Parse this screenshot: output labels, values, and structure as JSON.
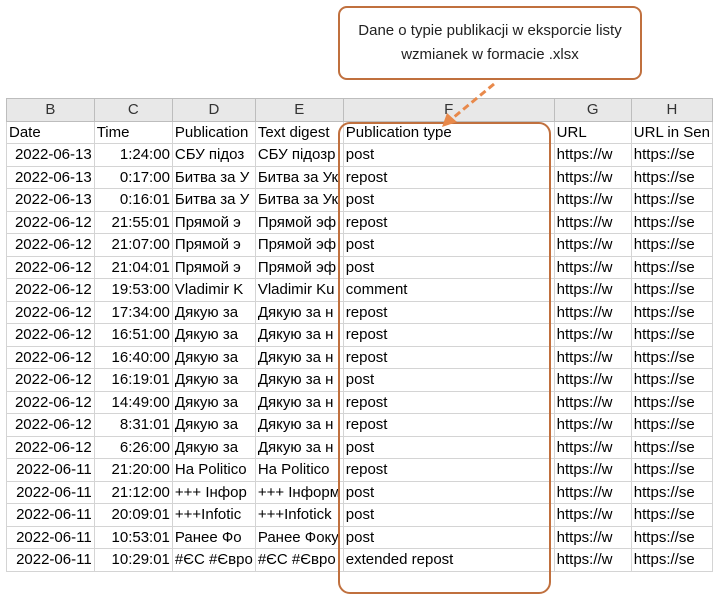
{
  "callout": {
    "text": "Dane o typie publikacji w eksporcie listy wzmianek w formacie .xlsx"
  },
  "sheet": {
    "column_letters": [
      "B",
      "C",
      "D",
      "E",
      "F",
      "G",
      "H"
    ],
    "headers": [
      "Date",
      "Time",
      "Publication",
      "Text digest",
      "Publication type",
      "URL",
      "URL in Sen"
    ],
    "rows": [
      [
        "2022-06-13",
        "1:24:00",
        "СБУ підоз",
        "СБУ підозр",
        "post",
        "https://w",
        "https://se"
      ],
      [
        "2022-06-13",
        "0:17:00",
        "Битва за У",
        "Битва за Ук",
        "repost",
        "https://w",
        "https://se"
      ],
      [
        "2022-06-13",
        "0:16:01",
        "Битва за У",
        "Битва за Ук",
        "post",
        "https://w",
        "https://se"
      ],
      [
        "2022-06-12",
        "21:55:01",
        "Прямой э",
        "Прямой эф",
        "repost",
        "https://w",
        "https://se"
      ],
      [
        "2022-06-12",
        "21:07:00",
        "Прямой э",
        "Прямой эф",
        "post",
        "https://w",
        "https://se"
      ],
      [
        "2022-06-12",
        "21:04:01",
        "Прямой э",
        "Прямой эф",
        "post",
        "https://w",
        "https://se"
      ],
      [
        "2022-06-12",
        "19:53:00",
        "Vladimir K",
        "Vladimir Ku",
        "comment",
        "https://w",
        "https://se"
      ],
      [
        "2022-06-12",
        "17:34:00",
        "Дякую за",
        "Дякую за н",
        "repost",
        "https://w",
        "https://se"
      ],
      [
        "2022-06-12",
        "16:51:00",
        "Дякую за",
        "Дякую за н",
        "repost",
        "https://w",
        "https://se"
      ],
      [
        "2022-06-12",
        "16:40:00",
        "Дякую за",
        "Дякую за н",
        "repost",
        "https://w",
        "https://se"
      ],
      [
        "2022-06-12",
        "16:19:01",
        "Дякую за",
        "Дякую за н",
        "post",
        "https://w",
        "https://se"
      ],
      [
        "2022-06-12",
        "14:49:00",
        "Дякую за",
        "Дякую за н",
        "repost",
        "https://w",
        "https://se"
      ],
      [
        "2022-06-12",
        "8:31:01",
        "Дякую за",
        "Дякую за н",
        "repost",
        "https://w",
        "https://se"
      ],
      [
        "2022-06-12",
        "6:26:00",
        "Дякую за",
        "Дякую за н",
        "post",
        "https://w",
        "https://se"
      ],
      [
        "2022-06-11",
        "21:20:00",
        "На Politico",
        "На Politico",
        "repost",
        "https://w",
        "https://se"
      ],
      [
        "2022-06-11",
        "21:12:00",
        "+++ Інфор",
        "+++ Інформ",
        "post",
        "https://w",
        "https://se"
      ],
      [
        "2022-06-11",
        "20:09:01",
        "+++Infotic",
        "+++Infotick",
        "post",
        "https://w",
        "https://se"
      ],
      [
        "2022-06-11",
        "10:53:01",
        "Ранее Фо",
        "Ранее Фоку",
        "post",
        "https://w",
        "https://se"
      ],
      [
        "2022-06-11",
        "10:29:01",
        "#ЄС #Євро",
        "#ЄС #Євро",
        "extended repost",
        "https://w",
        "https://se"
      ]
    ]
  },
  "colors": {
    "accent": "#c0703e",
    "connector": "#e8894b"
  }
}
